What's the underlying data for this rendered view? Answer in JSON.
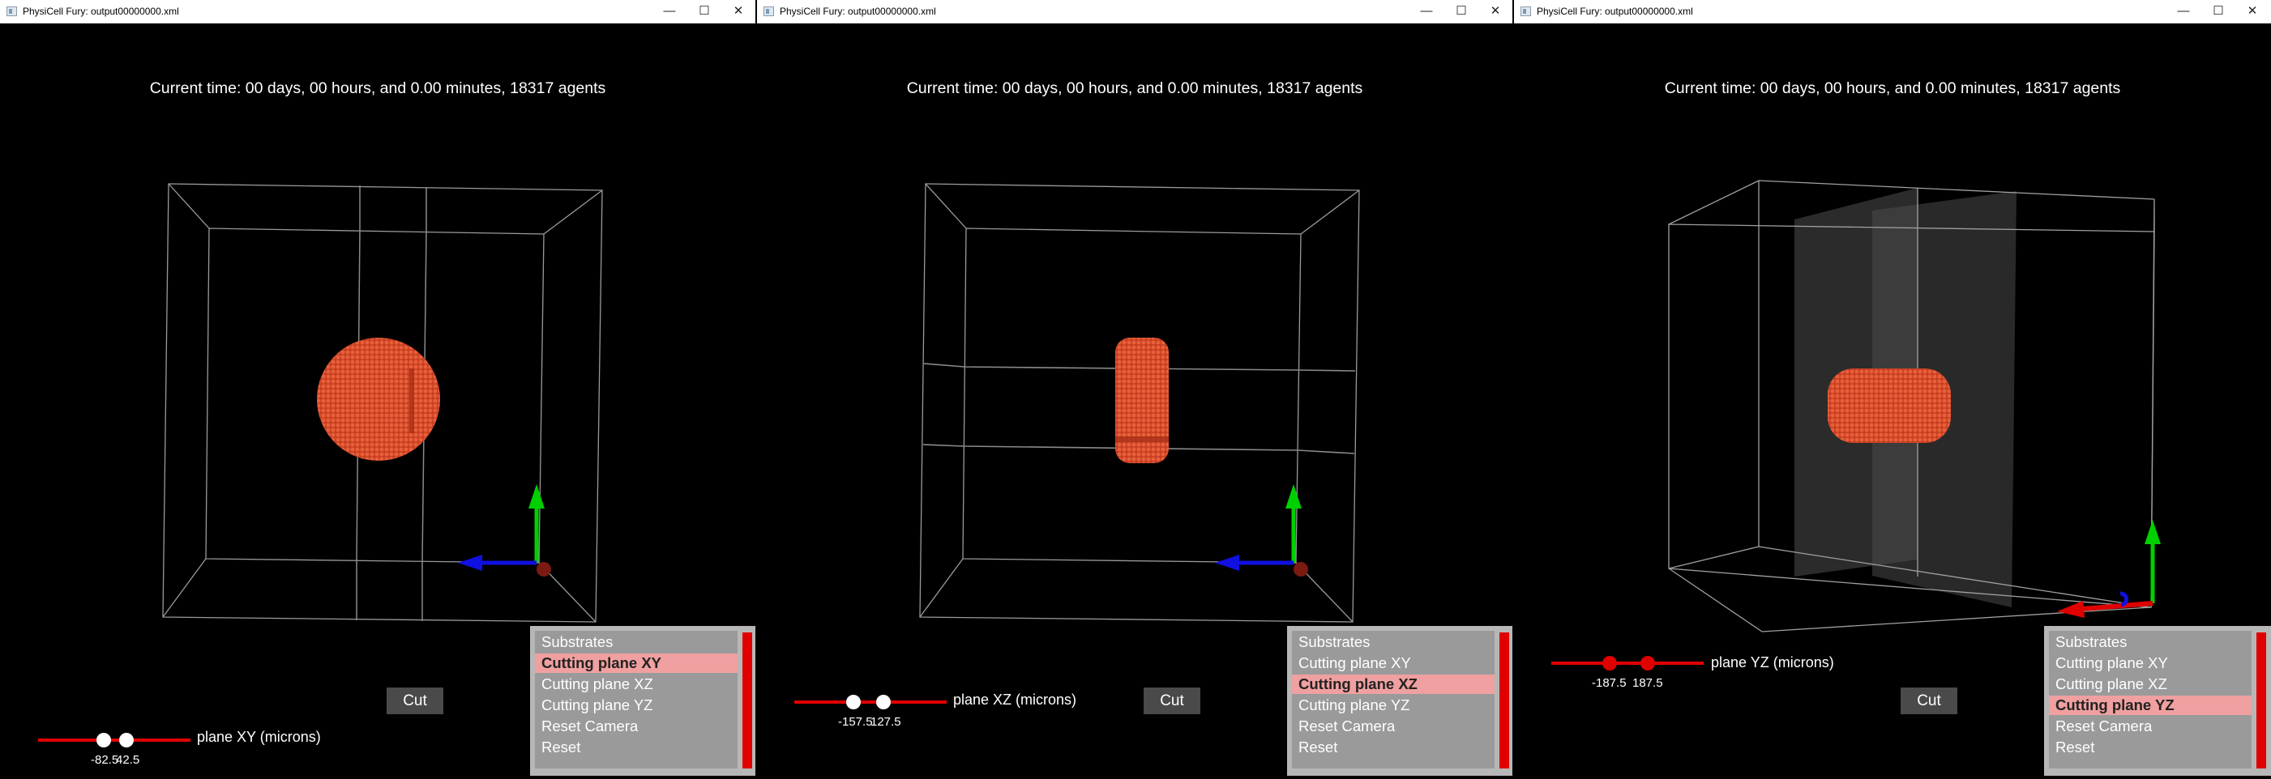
{
  "windows": [
    {
      "title": "PhysiCell Fury: output00000000.xml",
      "time_text": "Current time: 00 days, 00 hours, and 0.00 minutes, 18317 agents",
      "cut_label": "Cut",
      "slider": {
        "min_value": "-82.5",
        "max_value": "42.5",
        "plane_label": "plane XY (microns)"
      },
      "menu": {
        "items": [
          "Substrates",
          "Cutting plane XY",
          "Cutting plane XZ",
          "Cutting plane YZ",
          "Reset Camera",
          "Reset"
        ],
        "active": "Cutting plane XY"
      }
    },
    {
      "title": "PhysiCell Fury: output00000000.xml",
      "time_text": "Current time: 00 days, 00 hours, and 0.00 minutes, 18317 agents",
      "cut_label": "Cut",
      "slider": {
        "min_value": "-157.5",
        "max_value": "127.5",
        "plane_label": "plane XZ (microns)"
      },
      "menu": {
        "items": [
          "Substrates",
          "Cutting plane XY",
          "Cutting plane XZ",
          "Cutting plane YZ",
          "Reset Camera",
          "Reset"
        ],
        "active": "Cutting plane XZ"
      }
    },
    {
      "title": "PhysiCell Fury: output00000000.xml",
      "time_text": "Current time: 00 days, 00 hours, and 0.00 minutes, 18317 agents",
      "cut_label": "Cut",
      "slider": {
        "min_value": "-187.5",
        "max_value": "187.5",
        "plane_label": "plane YZ (microns)"
      },
      "menu": {
        "items": [
          "Substrates",
          "Cutting plane XY",
          "Cutting plane XZ",
          "Cutting plane YZ",
          "Reset Camera",
          "Reset"
        ],
        "active": "Cutting plane YZ"
      }
    }
  ],
  "window_controls": {
    "minimize": "—",
    "maximize": "☐",
    "close": "✕"
  },
  "colors": {
    "cells": "#d84a2a",
    "slider": "#e00000",
    "menu_active": "#f0a0a0",
    "axis_x": "#e00000",
    "axis_y": "#00d000",
    "axis_z": "#1010e0"
  }
}
